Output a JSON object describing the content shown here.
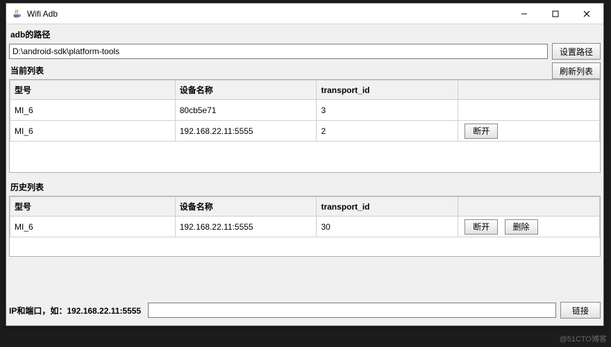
{
  "window": {
    "title": "Wifi Adb",
    "icon": "java-cup-icon"
  },
  "path_section": {
    "label": "adb的路径",
    "value": "D:\\android-sdk\\platform-tools",
    "set_button": "设置路径"
  },
  "current_list": {
    "heading": "当前列表",
    "refresh_button": "刷新列表",
    "columns": {
      "model": "型号",
      "name": "设备名称",
      "tid": "transport_id",
      "actions": ""
    },
    "rows": [
      {
        "model": "MI_6",
        "name": "80cb5e71",
        "tid": "3",
        "disconnect": null
      },
      {
        "model": "MI_6",
        "name": "192.168.22.11:5555",
        "tid": "2",
        "disconnect": "断开"
      }
    ]
  },
  "history_list": {
    "heading": "历史列表",
    "columns": {
      "model": "型号",
      "name": "设备名称",
      "tid": "transport_id",
      "actions": ""
    },
    "rows": [
      {
        "model": "MI_6",
        "name": "192.168.22.11:5555",
        "tid": "30",
        "disconnect": "断开",
        "delete": "删除"
      }
    ]
  },
  "footer": {
    "label": "IP和端口，如：192.168.22.11:5555",
    "value": "",
    "connect_button": "链接"
  },
  "watermark": "@51CTO博客"
}
